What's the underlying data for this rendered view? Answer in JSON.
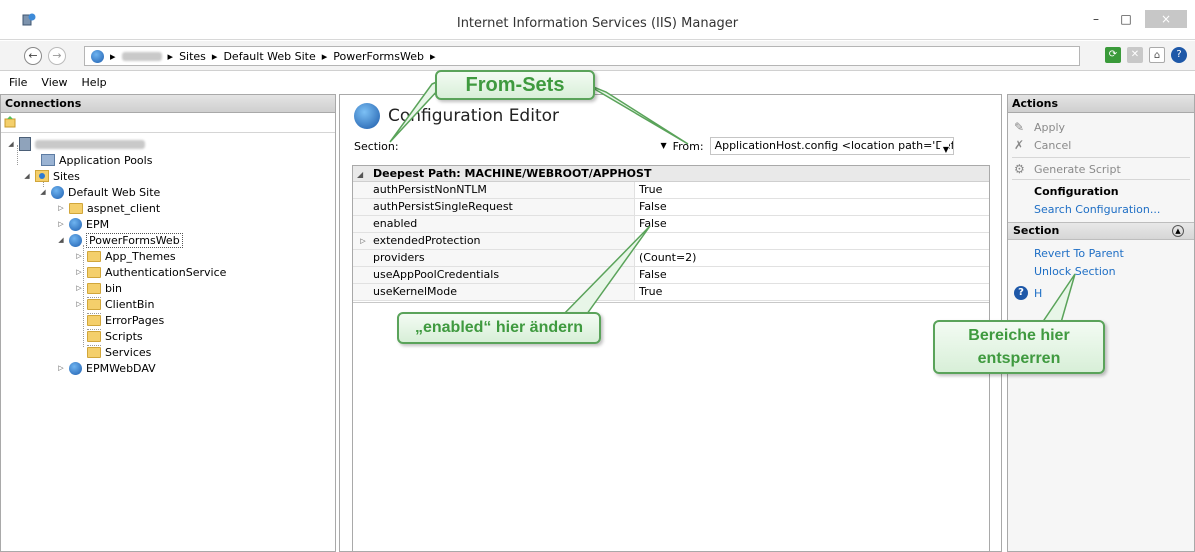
{
  "window": {
    "title": "Internet Information Services (IIS) Manager",
    "minimize": "–",
    "maximize": "□",
    "close": "×"
  },
  "address": {
    "back": "←",
    "forward": "→",
    "separator": "▸",
    "crumbs": [
      "Sites",
      "Default Web Site",
      "PowerFormsWeb"
    ]
  },
  "menu": [
    "File",
    "View",
    "Help"
  ],
  "connections": {
    "title": "Connections",
    "tree": {
      "app_pools": "Application Pools",
      "sites": "Sites",
      "default_site": "Default Web Site",
      "aspnet_client": "aspnet_client",
      "epm": "EPM",
      "powerformsweb": "PowerFormsWeb",
      "children": [
        "App_Themes",
        "AuthenticationService",
        "bin",
        "ClientBin",
        "ErrorPages",
        "Scripts",
        "Services"
      ],
      "epmwebdav": "EPMWebDAV"
    }
  },
  "editor": {
    "title": "Configuration Editor",
    "section_label": "Section:",
    "from_label": "From:",
    "from_value": "ApplicationHost.config <location path='Default We",
    "deepest_path": "Deepest Path: MACHINE/WEBROOT/APPHOST",
    "rows": [
      {
        "key": "authPersistNonNTLM",
        "value": "True",
        "expander": ""
      },
      {
        "key": "authPersistSingleRequest",
        "value": "False",
        "expander": ""
      },
      {
        "key": "enabled",
        "value": "False",
        "expander": ""
      },
      {
        "key": "extendedProtection",
        "value": "",
        "expander": "▷"
      },
      {
        "key": "providers",
        "value": "(Count=2)",
        "expander": ""
      },
      {
        "key": "useAppPoolCredentials",
        "value": "False",
        "expander": ""
      },
      {
        "key": "useKernelMode",
        "value": "True",
        "expander": ""
      }
    ]
  },
  "actions": {
    "title": "Actions",
    "apply": "Apply",
    "cancel": "Cancel",
    "generate_script": "Generate Script",
    "configuration": "Configuration",
    "search_configuration": "Search Configuration...",
    "section_header": "Section",
    "revert_to_parent": "Revert To Parent",
    "unlock_section": "Unlock Section",
    "help_fragment": "H"
  },
  "callouts": {
    "from_sets": "From-Sets",
    "enabled": "„enabled“ hier ändern",
    "unlock_line1": "Bereiche hier",
    "unlock_line2": "entsperren"
  },
  "colors": {
    "callout_green": "#3f9a3f",
    "link_blue": "#1f6fc5"
  }
}
